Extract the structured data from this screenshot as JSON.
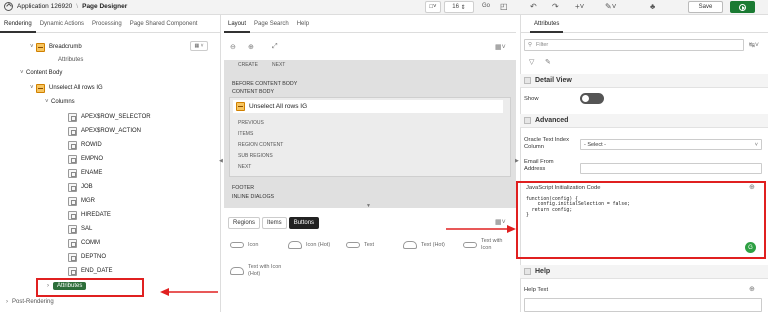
{
  "app": {
    "title": "Application 126920",
    "separator": "\\",
    "page_title": "Page Designer"
  },
  "toolbar": {
    "page_number": "16",
    "save_label": "Save"
  },
  "left_tabs": [
    "Rendering",
    "Dynamic Actions",
    "Processing",
    "Page Shared Component"
  ],
  "tree": {
    "breadcrumb": "Breadcrumb",
    "attributes_sub": "Attributes",
    "content_body": "Content Body",
    "region": "Unselect All rows IG",
    "columns_label": "Columns",
    "columns": [
      "APEX$ROW_SELECTOR",
      "APEX$ROW_ACTION",
      "ROWID",
      "EMPNO",
      "ENAME",
      "JOB",
      "MGR",
      "HIREDATE",
      "SAL",
      "COMM",
      "DEPTNO",
      "END_DATE"
    ],
    "attributes_node": "Attributes",
    "post_rendering": "Post-Rendering"
  },
  "middle": {
    "tabs": [
      "Layout",
      "Page Search",
      "Help"
    ],
    "top_slots": [
      "CREATE",
      "NEXT"
    ],
    "before_content": "BEFORE CONTENT BODY",
    "content_body": "CONTENT BODY",
    "region_title": "Unselect All rows IG",
    "region_slots": [
      "PREVIOUS",
      "ITEMS",
      "REGION CONTENT",
      "SUB REGIONS",
      "NEXT"
    ],
    "footer": "FOOTER",
    "inline_dialogs": "INLINE DIALOGS",
    "bottom_tabs": [
      "Regions",
      "Items",
      "Buttons"
    ],
    "active_bottom_tab": "Buttons",
    "button_templates": [
      "Icon",
      "Icon (Hot)",
      "Text",
      "Text (Hot)",
      "Text with Icon",
      "Text with Icon (Hot)"
    ]
  },
  "right": {
    "tab": "Attributes",
    "filter_placeholder": "Filter",
    "detail_view": "Detail View",
    "show_label": "Show",
    "advanced": "Advanced",
    "oracle_text_index_label": "Oracle Text Index Column",
    "oracle_text_index_value": "- Select -",
    "email_from_label": "Email From Address",
    "js_init_label": "JavaScript Initialization Code",
    "js_code": "function(config) {\n    config.initialSelection = false;\n  return config;\n}",
    "help_section": "Help",
    "help_text_label": "Help Text"
  },
  "colors": {
    "accent_red": "#e02020",
    "brand_green": "#1a7a32",
    "attr_green": "#2d6e3a"
  }
}
